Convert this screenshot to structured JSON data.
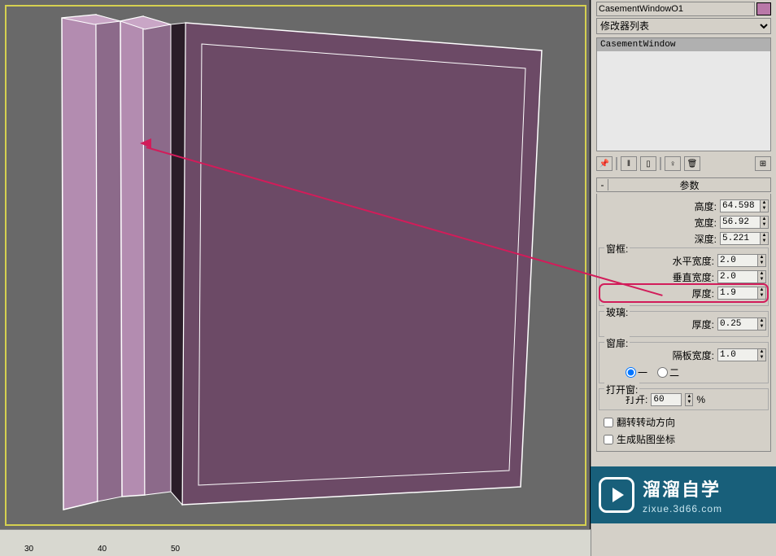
{
  "object_name": "CasementWindowO1",
  "modifier_list_label": "修改器列表",
  "stack": {
    "item": "CasementWindow"
  },
  "rollout_title": "参数",
  "dims": {
    "height_label": "高度:",
    "height": "64.598",
    "width_label": "宽度:",
    "width": "56.92",
    "depth_label": "深度:",
    "depth": "5.221"
  },
  "frame": {
    "legend": "窗框:",
    "hwidth_label": "水平宽度:",
    "hwidth": "2.0",
    "vwidth_label": "垂直宽度:",
    "vwidth": "2.0",
    "thick_label": "厚度:",
    "thick": "1.9"
  },
  "glass": {
    "legend": "玻璃:",
    "thick_label": "厚度:",
    "thick": "0.25"
  },
  "sash": {
    "legend": "窗扉:",
    "panel_width_label": "隔板宽度:",
    "panel_width": "1.0",
    "radio_one": "一",
    "radio_two": "二"
  },
  "open": {
    "legend": "打开窗:",
    "label": "打开:",
    "value": "60",
    "percent": "%"
  },
  "check_flip": "翻转转动方向",
  "check_uv": "生成贴图坐标",
  "toolbar": {
    "pin": "📌",
    "stack1": "‖",
    "stack2": "▯",
    "bulb": "♀",
    "trash": "🗑",
    "config": "⊞"
  },
  "watermark": {
    "line1": "溜溜自学",
    "line2": "zixue.3d66.com"
  },
  "ruler": {
    "t30": "30",
    "t40": "40",
    "t50": "50"
  }
}
